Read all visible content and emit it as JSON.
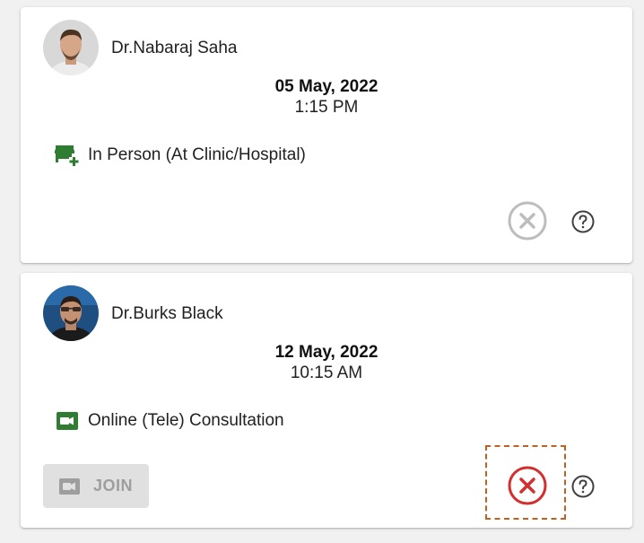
{
  "appointments": [
    {
      "doctor_name": "Dr.Nabaraj Saha",
      "date": "05 May, 2022",
      "time": "1:15 PM",
      "mode_icon": "clinic-icon",
      "mode_label": "In Person (At Clinic/Hospital)",
      "cancel_state": "disabled",
      "cancel_color": "#bdbdbd"
    },
    {
      "doctor_name": "Dr.Burks Black",
      "date": "12 May, 2022",
      "time": "10:15 AM",
      "mode_icon": "video-camera-icon",
      "mode_label": "Online (Tele) Consultation",
      "join_label": "JOIN",
      "join_state": "disabled",
      "cancel_state": "active",
      "cancel_color": "#d32f2f",
      "cancel_highlighted": true
    }
  ],
  "colors": {
    "mode_icon_green": "#2e7d32",
    "help_icon": "#424242",
    "highlight_border": "#c0611f"
  }
}
